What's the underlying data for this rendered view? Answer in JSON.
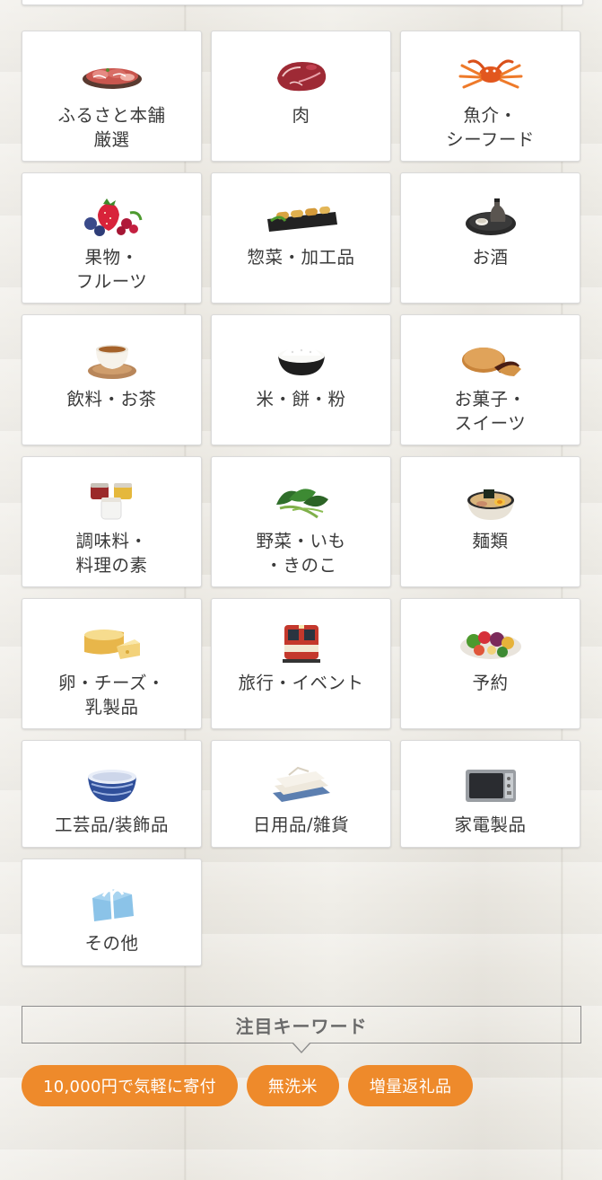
{
  "categories": [
    {
      "label": "ふるさと本舗\n厳選",
      "icon": "sliced-meat-platter-icon"
    },
    {
      "label": "肉",
      "icon": "beef-steak-icon"
    },
    {
      "label": "魚介・\nシーフード",
      "icon": "crab-icon"
    },
    {
      "label": "果物・\nフルーツ",
      "icon": "berries-icon"
    },
    {
      "label": "惣菜・加工品",
      "icon": "spring-rolls-icon"
    },
    {
      "label": "お酒",
      "icon": "sake-set-icon"
    },
    {
      "label": "飲料・お茶",
      "icon": "tea-cup-icon"
    },
    {
      "label": "米・餅・粉",
      "icon": "rice-bowl-icon"
    },
    {
      "label": "お菓子・\nスイーツ",
      "icon": "dorayaki-icon"
    },
    {
      "label": "調味料・\n料理の素",
      "icon": "condiment-jars-icon"
    },
    {
      "label": "野菜・いも\n・きのこ",
      "icon": "leafy-greens-icon"
    },
    {
      "label": "麺類",
      "icon": "ramen-bowl-icon"
    },
    {
      "label": "卵・チーズ・\n乳製品",
      "icon": "cheese-icon"
    },
    {
      "label": "旅行・イベント",
      "icon": "train-icon"
    },
    {
      "label": "予約",
      "icon": "vegetable-platter-icon"
    },
    {
      "label": "工芸品/装飾品",
      "icon": "ceramic-bowl-icon"
    },
    {
      "label": "日用品/雑貨",
      "icon": "towels-icon"
    },
    {
      "label": "家電製品",
      "icon": "microwave-oven-icon"
    },
    {
      "label": "その他",
      "icon": "gift-box-icon"
    }
  ],
  "keywords": {
    "title": "注目キーワード",
    "tags": [
      "10,000円で気軽に寄付",
      "無洗米",
      "増量返礼品"
    ]
  },
  "colors": {
    "accent": "#ee8a2b",
    "card_bg": "#ffffff",
    "text": "#3a3a3a"
  }
}
